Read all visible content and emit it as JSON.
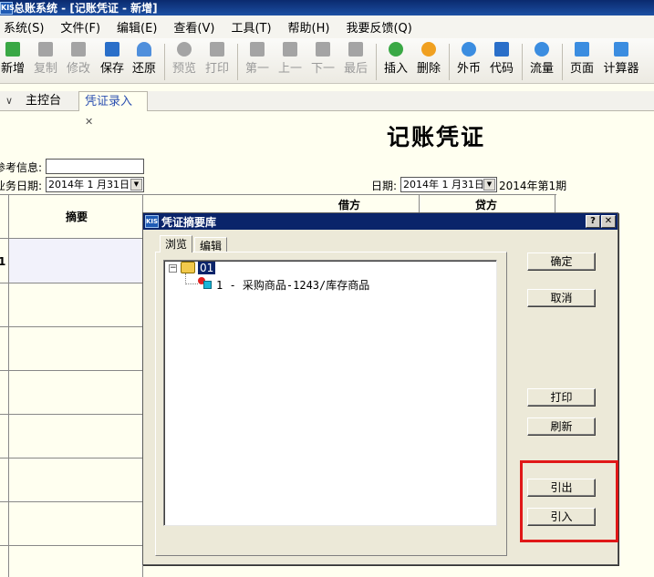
{
  "window": {
    "title": "总账系统 - [记账凭证 - 新增]",
    "logo": "KIS"
  },
  "menu": [
    "系统(S)",
    "文件(F)",
    "编辑(E)",
    "查看(V)",
    "工具(T)",
    "帮助(H)",
    "我要反馈(Q)"
  ],
  "toolbar": {
    "new": "新增",
    "copy": "复制",
    "edit": "修改",
    "save": "保存",
    "restore": "还原",
    "preview": "预览",
    "print": "打印",
    "first": "第一",
    "prev": "上一",
    "next": "下一",
    "last": "最后",
    "insert": "插入",
    "delete": "删除",
    "foreign": "外币",
    "code": "代码",
    "flow": "流量",
    "page": "页面",
    "calculator": "计算器"
  },
  "tabs": {
    "home": "主控台",
    "voucher": "凭证录入"
  },
  "voucher": {
    "title": "记账凭证",
    "ref_label": "参考信息:",
    "ref_value": "",
    "bizdate_label": "业务日期:",
    "bizdate_value": "2014年 1 月31日",
    "date_label": "日期:",
    "date_value": "2014年 1 月31日",
    "period": "2014年第1期",
    "col_summary": "摘要",
    "col_debit": "借方",
    "col_credit": "贷方",
    "row_first": "1"
  },
  "dialog": {
    "title": "凭证摘要库",
    "logo": "KIS",
    "help": "?",
    "close": "✕",
    "tab_browse": "浏览",
    "tab_edit": "编辑",
    "tree_root": "01",
    "tree_item": "1 - 采购商品-1243/库存商品",
    "btn_ok": "确定",
    "btn_cancel": "取消",
    "btn_print": "打印",
    "btn_refresh": "刷新",
    "btn_export": "引出",
    "btn_import": "引入"
  },
  "colors": {
    "titlebar": "#0a246a",
    "highlight": "#e01818",
    "accent_green": "#3aa845",
    "accent_blue": "#2a6fc9"
  }
}
